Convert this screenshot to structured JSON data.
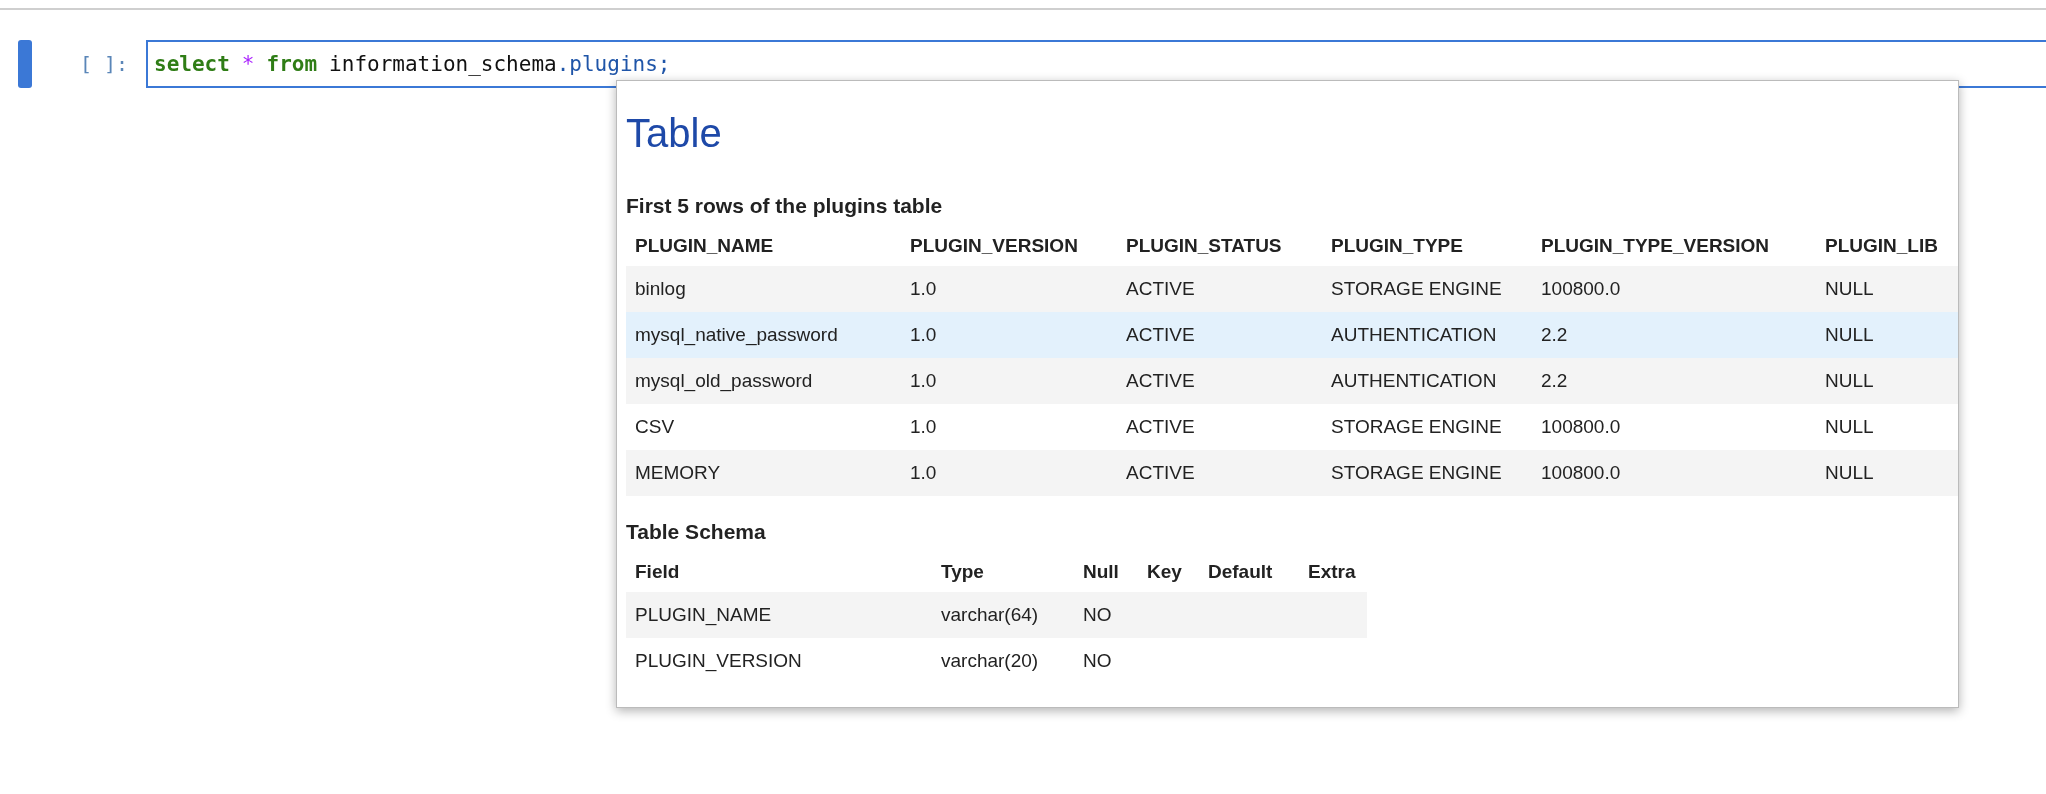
{
  "cell": {
    "prompt": "[ ]:",
    "selected": true,
    "code": [
      {
        "kind": "keyword",
        "text": "select"
      },
      {
        "kind": "operator",
        "text": "*"
      },
      {
        "kind": "keyword",
        "text": "from"
      },
      {
        "kind": "name",
        "text": "information_schema"
      },
      {
        "kind": "attr",
        "text": ".plugins;"
      }
    ]
  },
  "tooltip": {
    "title": "Table",
    "preview": {
      "heading": "First 5 rows of the plugins table",
      "columns": [
        "PLUGIN_NAME",
        "PLUGIN_VERSION",
        "PLUGIN_STATUS",
        "PLUGIN_TYPE",
        "PLUGIN_TYPE_VERSION",
        "PLUGIN_LIB"
      ],
      "rows": [
        {
          "selected": false,
          "cells": [
            "binlog",
            "1.0",
            "ACTIVE",
            "STORAGE ENGINE",
            "100800.0",
            "NULL"
          ]
        },
        {
          "selected": true,
          "cells": [
            "mysql_native_password",
            "1.0",
            "ACTIVE",
            "AUTHENTICATION",
            "2.2",
            "NULL"
          ]
        },
        {
          "selected": false,
          "cells": [
            "mysql_old_password",
            "1.0",
            "ACTIVE",
            "AUTHENTICATION",
            "2.2",
            "NULL"
          ]
        },
        {
          "selected": false,
          "cells": [
            "CSV",
            "1.0",
            "ACTIVE",
            "STORAGE ENGINE",
            "100800.0",
            "NULL"
          ]
        },
        {
          "selected": false,
          "cells": [
            "MEMORY",
            "1.0",
            "ACTIVE",
            "STORAGE ENGINE",
            "100800.0",
            "NULL"
          ]
        }
      ]
    },
    "schema": {
      "heading": "Table Schema",
      "columns": [
        "Field",
        "Type",
        "Null",
        "Key",
        "Default",
        "Extra"
      ],
      "rows": [
        {
          "cells": [
            "PLUGIN_NAME",
            "varchar(64)",
            "NO",
            "",
            "",
            ""
          ]
        },
        {
          "cells": [
            "PLUGIN_VERSION",
            "varchar(20)",
            "NO",
            "",
            "",
            ""
          ]
        }
      ]
    }
  }
}
